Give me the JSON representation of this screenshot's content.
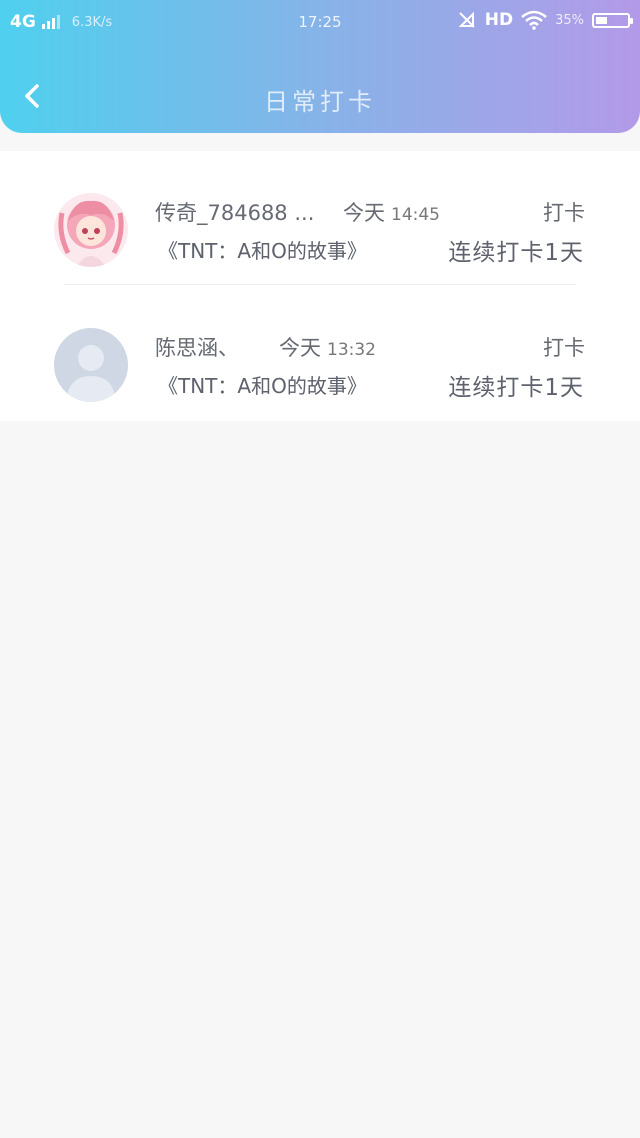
{
  "status_bar": {
    "network": "4G",
    "speed": "6.3K/s",
    "time": "17:25",
    "hd": "HD",
    "battery_percent": "35%",
    "battery_level": 0.35
  },
  "nav": {
    "title": "日常打卡",
    "back_icon": "chevron-left-icon"
  },
  "checkins": [
    {
      "username": "传奇_784688 ...",
      "day": "今天",
      "time": "14:45",
      "action": "打卡",
      "book": "《TNT：A和O的故事》",
      "streak": "连续打卡1天",
      "avatar": "anime-avatar"
    },
    {
      "username": "陈思涵、",
      "day": "今天",
      "time": "13:32",
      "action": "打卡",
      "book": "《TNT：A和O的故事》",
      "streak": "连续打卡1天",
      "avatar": "default-avatar"
    }
  ],
  "colors": {
    "header_gradient_start": "#4fd0ee",
    "header_gradient_end": "#b39ae8",
    "text": "#666a72",
    "background": "#f7f7f7"
  }
}
